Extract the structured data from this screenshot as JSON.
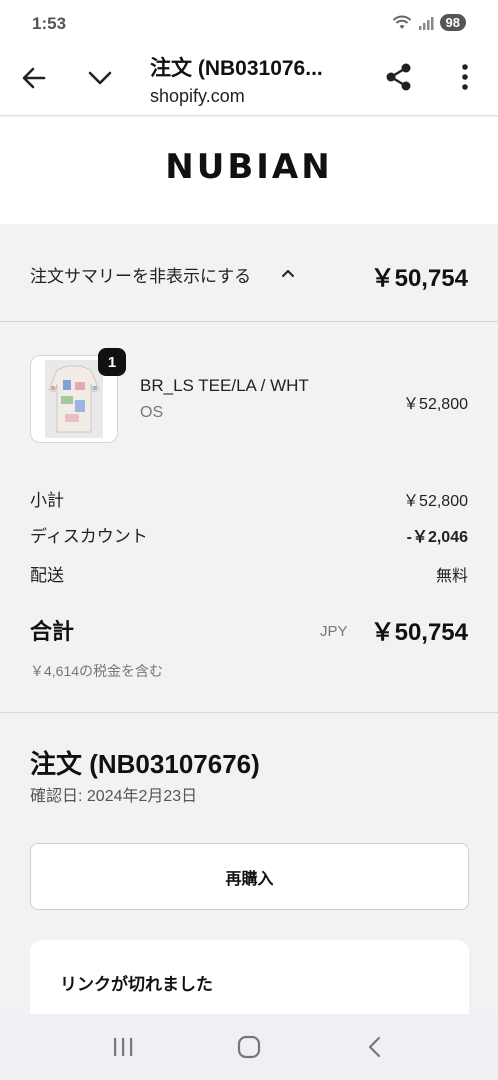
{
  "status_bar": {
    "time": "1:53",
    "battery": "98",
    "icons": [
      "wifi-icon",
      "signal-icon",
      "battery-icon"
    ]
  },
  "app_bar": {
    "title": "注文 (NB031076...",
    "domain": "shopify.com",
    "icons": [
      "back-arrow-icon",
      "chevron-down-icon",
      "share-icon",
      "more-vertical-icon"
    ]
  },
  "brand": {
    "logo_text": "NUBIAN"
  },
  "summary": {
    "toggle_label": "注文サマリーを非表示にする",
    "total": "￥50,754"
  },
  "product": {
    "quantity": "1",
    "name": "BR_LS TEE/LA / WHT",
    "variant": "OS",
    "price": "￥52,800"
  },
  "totals": {
    "subtotal_label": "小計",
    "subtotal_value": "￥52,800",
    "discount_label": "ディスカウント",
    "discount_value": "-￥2,046",
    "shipping_label": "配送",
    "shipping_value": "無料",
    "total_label": "合計",
    "currency": "JPY",
    "total_value": "￥50,754",
    "tax_note": "￥4,614の税金を含む"
  },
  "order": {
    "title": "注文 (NB03107676)",
    "confirmed_date": "確認日: 2024年2月23日",
    "rebuy_label": "再購入",
    "link_expired_title": "リンクが切れました"
  },
  "nav": {
    "icons": [
      "recent-apps-icon",
      "home-icon",
      "back-icon"
    ]
  },
  "colors": {
    "background": "#f2f2f2",
    "surface": "#ffffff",
    "text": "#111111",
    "muted": "#777777",
    "badge": "#111111"
  }
}
